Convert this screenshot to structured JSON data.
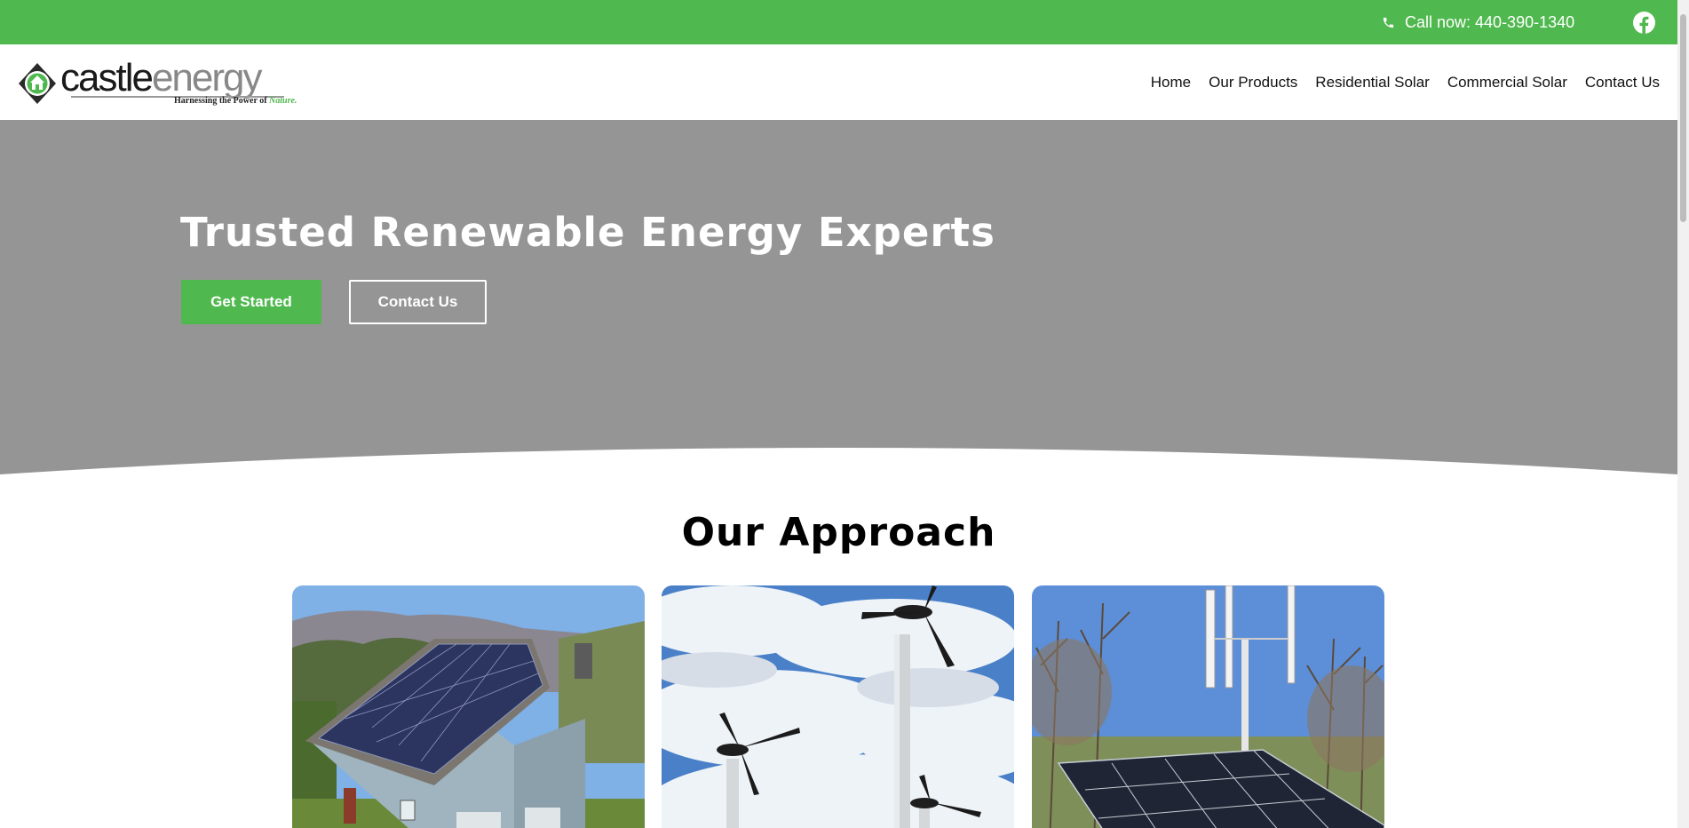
{
  "topbar": {
    "phone_label": "Call now: 440-390-1340",
    "phone_icon": "phone-icon",
    "social_icon": "facebook-icon",
    "bg_color": "#4fb84e"
  },
  "logo": {
    "name_part1": "castle",
    "name_part2": "energy",
    "tagline_prefix": "Harnessing the Power of ",
    "tagline_emphasis": "Nature."
  },
  "nav": {
    "items": [
      "Home",
      "Our Products",
      "Residential Solar",
      "Commercial Solar",
      "Contact Us"
    ]
  },
  "hero": {
    "title": "Trusted Renewable Energy Experts",
    "primary_button": "Get Started",
    "secondary_button": "Contact Us",
    "bg_color": "#959595"
  },
  "approach": {
    "title": "Our Approach",
    "cards": [
      {
        "image": "house-with-solar-roof"
      },
      {
        "image": "small-wind-turbines-sky"
      },
      {
        "image": "ground-solar-array-with-vertical-turbine"
      }
    ]
  },
  "colors": {
    "accent": "#4fb84e",
    "hero_grey": "#959595"
  }
}
